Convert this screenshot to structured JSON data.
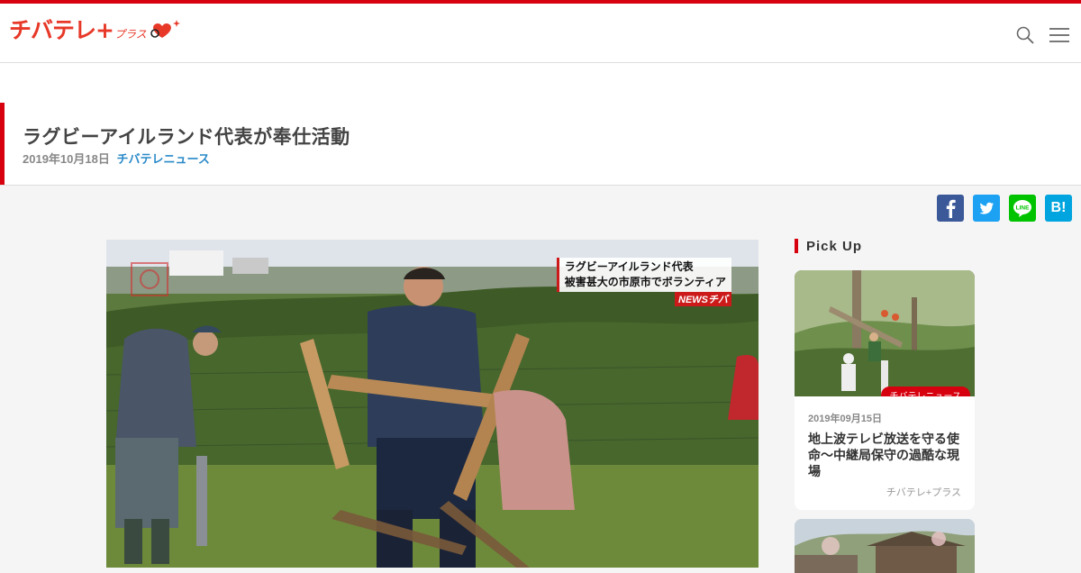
{
  "brand": {
    "logo_text": "チバテレ+",
    "logo_sub": "プラス",
    "accent": "#d7000f"
  },
  "header": {
    "search_icon": "search-icon",
    "menu_icon": "hamburger-menu-icon"
  },
  "article": {
    "title": "ラグビーアイルランド代表が奉仕活動",
    "date": "2019年10月18日",
    "category": "チバテレニュース"
  },
  "share": {
    "facebook": "f",
    "hatena": "B!"
  },
  "video": {
    "telop_line1": "ラグビーアイルランド代表",
    "telop_line2": "被害甚大の市原市でボランティア",
    "telop_brand": "NEWSチバ"
  },
  "sidebar": {
    "heading": "Pick Up",
    "cards": [
      {
        "badge": "チバテレニュース",
        "date": "2019年09月15日",
        "title": "地上波テレビ放送を守る使命～中継局保守の過酷な現場",
        "source": "チバテレ+プラス"
      }
    ]
  }
}
